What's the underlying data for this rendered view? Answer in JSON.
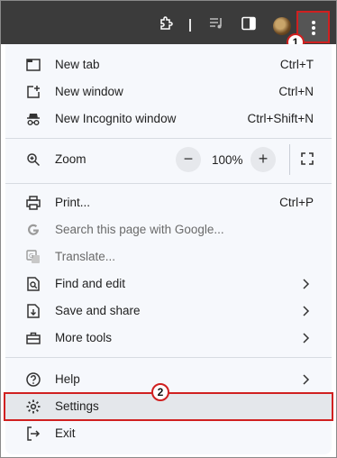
{
  "toolbar": {
    "icons": [
      "extension-icon",
      "media-control-icon",
      "side-panel-icon",
      "profile-avatar",
      "more-options-icon"
    ]
  },
  "annotations": {
    "badge_1": "1",
    "badge_2": "2",
    "highlight_color": "#d02020"
  },
  "menu": {
    "new_tab": {
      "label": "New tab",
      "shortcut": "Ctrl+T"
    },
    "new_window": {
      "label": "New window",
      "shortcut": "Ctrl+N"
    },
    "new_incognito": {
      "label": "New Incognito window",
      "shortcut": "Ctrl+Shift+N"
    },
    "zoom": {
      "label": "Zoom",
      "minus": "−",
      "value": "100%",
      "plus": "+"
    },
    "print": {
      "label": "Print...",
      "shortcut": "Ctrl+P"
    },
    "search_google": {
      "label": "Search this page with Google..."
    },
    "translate": {
      "label": "Translate..."
    },
    "find_edit": {
      "label": "Find and edit"
    },
    "save_share": {
      "label": "Save and share"
    },
    "more_tools": {
      "label": "More tools"
    },
    "help": {
      "label": "Help"
    },
    "settings": {
      "label": "Settings"
    },
    "exit": {
      "label": "Exit"
    }
  }
}
